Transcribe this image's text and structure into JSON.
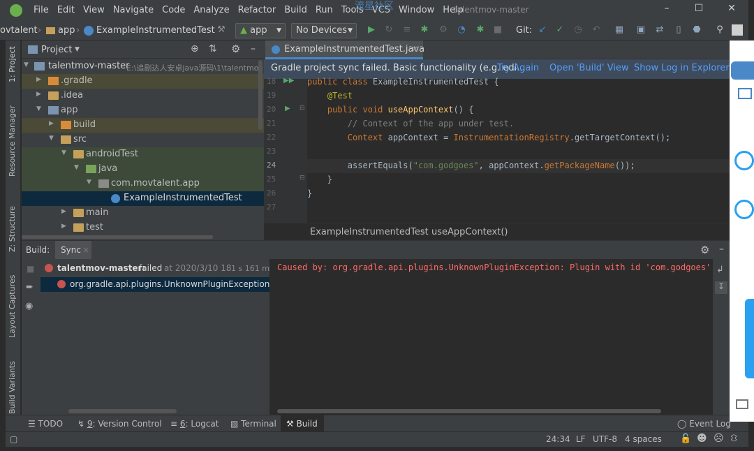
{
  "title_bar": {
    "menu": [
      "File",
      "Edit",
      "View",
      "Navigate",
      "Code",
      "Analyze",
      "Refactor",
      "Build",
      "Run",
      "Tools",
      "VCS",
      "Window",
      "Help"
    ],
    "project_title": "talentmov-master",
    "watermark": "流星社区"
  },
  "toolbar": {
    "breadcrumb": [
      "ovtalent",
      "app",
      "ExampleInstrumentedTest"
    ],
    "run_config": "app",
    "device": "No Devices",
    "git_label": "Git:"
  },
  "left_strip": {
    "tabs": [
      "1: Project",
      "Resource Manager",
      "Z: Structure",
      "Layout Captures",
      "Build Variants"
    ]
  },
  "project_panel": {
    "title": "Project",
    "tree": [
      {
        "label": "talentmov-master",
        "path": "E:\\追剧达人安卓java源码\\1\\talentmo"
      },
      {
        "label": ".gradle"
      },
      {
        "label": ".idea"
      },
      {
        "label": "app"
      },
      {
        "label": "build"
      },
      {
        "label": "src"
      },
      {
        "label": "androidTest"
      },
      {
        "label": "java"
      },
      {
        "label": "com.movtalent.app"
      },
      {
        "label": "ExampleInstrumentedTest"
      },
      {
        "label": "main"
      },
      {
        "label": "test"
      }
    ]
  },
  "editor": {
    "tab_label": "ExampleInstrumentedTest.java",
    "notification": {
      "text": "Gradle project sync failed. Basic functionality (e.g. edi...",
      "actions": [
        "Try Again",
        "Open 'Build' View",
        "Show Log in Explorer"
      ]
    },
    "lines": [
      {
        "n": "18",
        "tokens": [
          [
            "kw",
            "public class "
          ],
          [
            "plain",
            "ExampleInstrumentedTest {"
          ]
        ]
      },
      {
        "n": "19",
        "tokens": [
          [
            "plain",
            "    "
          ],
          [
            "ann",
            "@Test"
          ]
        ]
      },
      {
        "n": "20",
        "tokens": [
          [
            "plain",
            "    "
          ],
          [
            "kw",
            "public void "
          ],
          [
            "fn",
            "useAppContext"
          ],
          [
            "plain",
            "() {"
          ]
        ]
      },
      {
        "n": "21",
        "tokens": [
          [
            "plain",
            "        "
          ],
          [
            "cm",
            "// Context of the app under test."
          ]
        ]
      },
      {
        "n": "22",
        "tokens": [
          [
            "plain",
            "        "
          ],
          [
            "cls",
            "Context "
          ],
          [
            "plain",
            "appContext = "
          ],
          [
            "cls",
            "InstrumentationRegistry"
          ],
          [
            "plain",
            "."
          ],
          [
            "plain",
            "getTargetContext();"
          ]
        ]
      },
      {
        "n": "23",
        "tokens": []
      },
      {
        "n": "24",
        "tokens": [
          [
            "plain",
            "        assertEquals("
          ],
          [
            "str",
            "\"com.godgoes\""
          ],
          [
            "plain",
            ", appContext."
          ],
          [
            "cls",
            "getPackageName"
          ],
          [
            "plain",
            "());"
          ]
        ]
      },
      {
        "n": "25",
        "tokens": [
          [
            "plain",
            "    }"
          ]
        ]
      },
      {
        "n": "26",
        "tokens": [
          [
            "plain",
            "}"
          ]
        ]
      },
      {
        "n": "27",
        "tokens": []
      }
    ],
    "breadcrumb": [
      "ExampleInstrumentedTest",
      "useAppContext()"
    ]
  },
  "build_panel": {
    "title": "Build:",
    "tab": "Sync",
    "root_label": "talentmov-master:",
    "root_status": "failed",
    "root_time": "at 2020/3/10 18",
    "root_duration": "1 s 161 ms",
    "error_item": "org.gradle.api.plugins.UnknownPluginException: I",
    "output": "Caused by: org.gradle.api.plugins.UnknownPluginException: Plugin with id 'com.godgoes' no"
  },
  "bottom_tabs": [
    {
      "key": "",
      "label": "TODO"
    },
    {
      "key": "9",
      "label": ": Version Control"
    },
    {
      "key": "6",
      "label": ": Logcat"
    },
    {
      "key": "",
      "label": "Terminal"
    },
    {
      "key": "",
      "label": "Build"
    }
  ],
  "event_log": "Event Log",
  "status": {
    "position": "24:34",
    "line_sep": "LF",
    "encoding": "UTF-8",
    "indent": "4 spaces"
  },
  "colors": {
    "accent": "#4a88c7",
    "error": "#c75450",
    "run_green": "#59a869"
  }
}
